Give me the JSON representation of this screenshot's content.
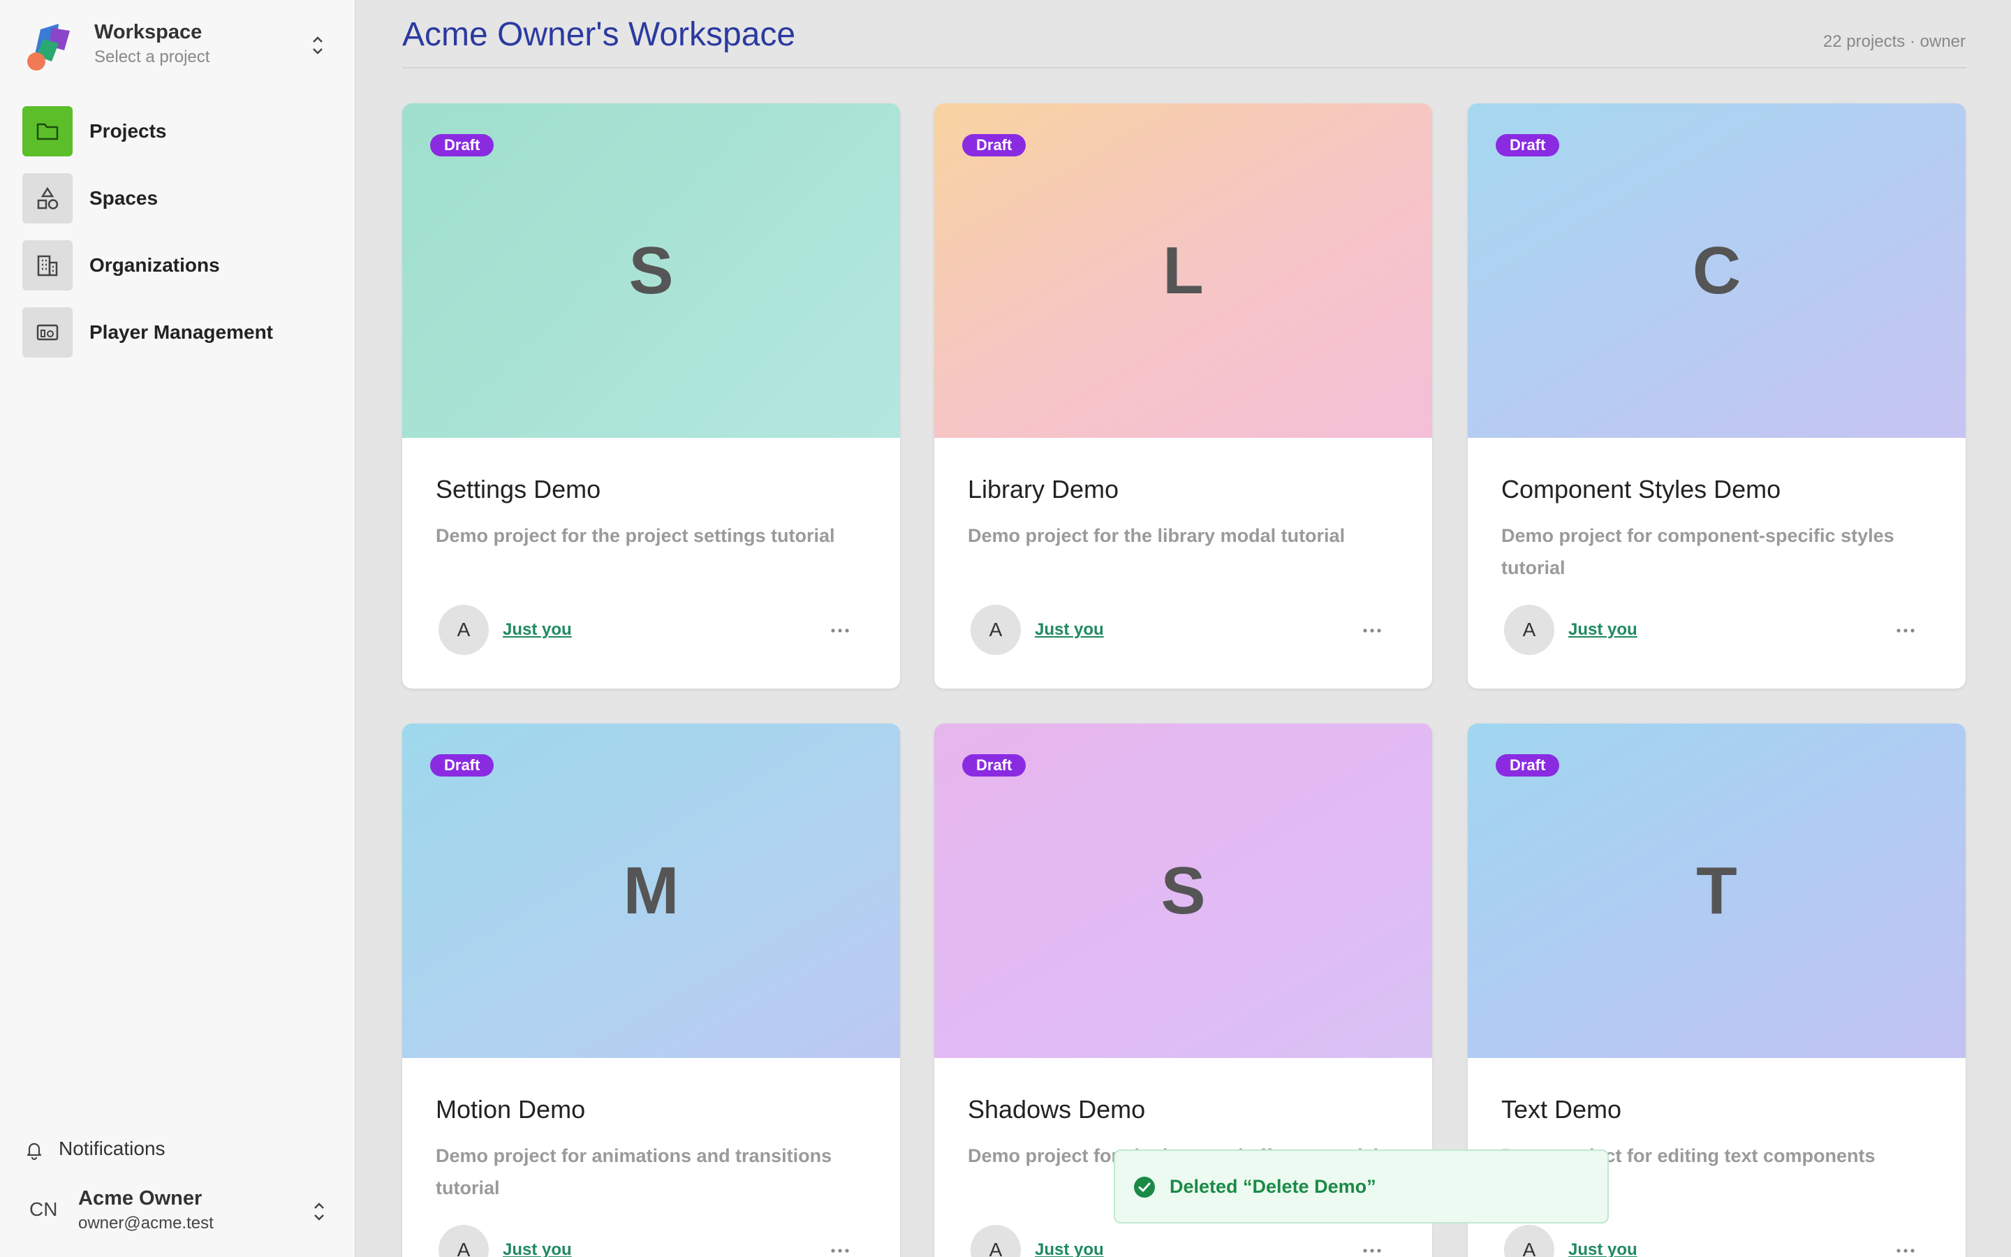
{
  "workspace": {
    "title": "Workspace",
    "subtitle": "Select a project"
  },
  "nav": [
    {
      "label": "Projects",
      "icon": "folder-icon",
      "active": true
    },
    {
      "label": "Spaces",
      "icon": "shapes-icon"
    },
    {
      "label": "Organizations",
      "icon": "building-icon"
    },
    {
      "label": "Player Management",
      "icon": "player-icon"
    }
  ],
  "notifications": {
    "label": "Notifications"
  },
  "user": {
    "initials": "CN",
    "name": "Acme Owner",
    "email": "owner@acme.test"
  },
  "page": {
    "title": "Acme Owner's Workspace",
    "meta": "22 projects · owner"
  },
  "projects": [
    {
      "badge": "Draft",
      "letter": "S",
      "title": "Settings Demo",
      "description": "Demo project for the project settings tutorial",
      "avatar": "A",
      "share": "Just you"
    },
    {
      "badge": "Draft",
      "letter": "L",
      "title": "Library Demo",
      "description": "Demo project for the library modal tutorial",
      "avatar": "A",
      "share": "Just you"
    },
    {
      "badge": "Draft",
      "letter": "C",
      "title": "Component Styles Demo",
      "description": "Demo project for component-specific styles tutorial",
      "avatar": "A",
      "share": "Just you"
    },
    {
      "badge": "Draft",
      "letter": "M",
      "title": "Motion Demo",
      "description": "Demo project for animations and transitions tutorial",
      "avatar": "A",
      "share": "Just you"
    },
    {
      "badge": "Draft",
      "letter": "S",
      "title": "Shadows Demo",
      "description": "Demo project for shadows and effects tutorial",
      "avatar": "A",
      "share": "Just you"
    },
    {
      "badge": "Draft",
      "letter": "T",
      "title": "Text Demo",
      "description": "Demo project for editing text components tutorial",
      "avatar": "A",
      "share": "Just you"
    }
  ],
  "toast": {
    "message": "Deleted “Delete Demo”"
  },
  "colors": {
    "accent": "#2b3aa0",
    "active_nav": "#5cbf2a",
    "badge": "#8a2be2",
    "link": "#1f8a5f",
    "toast_text": "#1a8a45"
  }
}
